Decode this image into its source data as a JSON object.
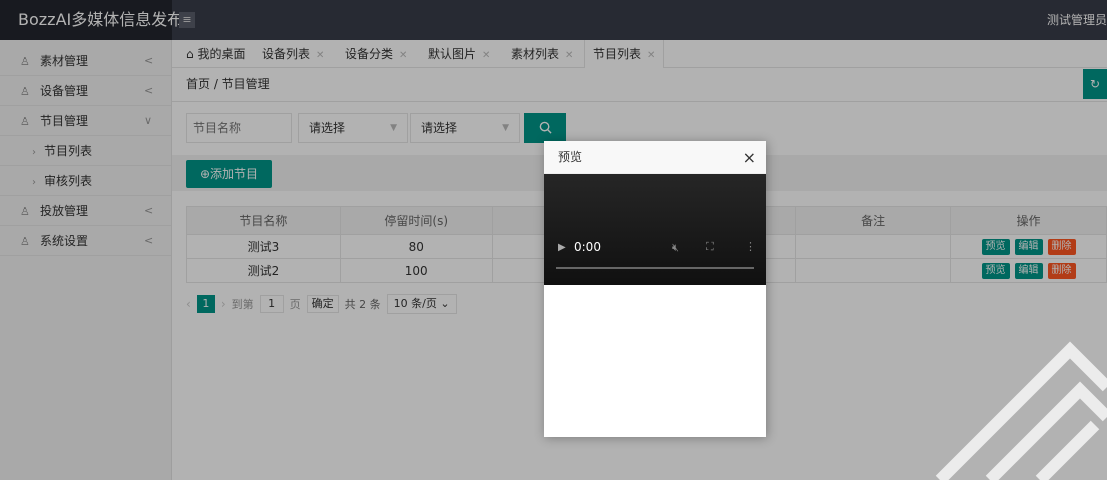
{
  "header": {
    "app_title": "BozzAI多媒体信息发布",
    "menu_toggle": "≡",
    "user": "测试管理员"
  },
  "sidebar": {
    "items": [
      {
        "label": "素材管理",
        "chevron": "<"
      },
      {
        "label": "设备管理",
        "chevron": "<"
      },
      {
        "label": "节目管理",
        "chevron": "∨"
      },
      {
        "label": "投放管理",
        "chevron": "<"
      },
      {
        "label": "系统设置",
        "chevron": "<"
      }
    ],
    "subitems": [
      {
        "label": "节目列表"
      },
      {
        "label": "审核列表"
      }
    ]
  },
  "tabs": [
    {
      "label": "我的桌面"
    },
    {
      "label": "设备列表"
    },
    {
      "label": "设备分类"
    },
    {
      "label": "默认图片"
    },
    {
      "label": "素材列表"
    },
    {
      "label": "节目列表"
    }
  ],
  "breadcrumb": "首页 / 节目管理",
  "search": {
    "name_placeholder": "节目名称",
    "select1": "请选择",
    "select2": "请选择"
  },
  "toolbar": {
    "add_label": "添加节目"
  },
  "table": {
    "headers": [
      "节目名称",
      "停留时间(s)",
      "",
      "",
      "备注",
      "操作"
    ],
    "rows": [
      {
        "name": "测试3",
        "duration": "80"
      },
      {
        "name": "测试2",
        "duration": "100"
      }
    ],
    "ops": {
      "preview": "预览",
      "edit": "编辑",
      "delete": "删除"
    }
  },
  "pager": {
    "current": "1",
    "goto": "到第",
    "goto_value": "1",
    "page_unit": "页",
    "confirm": "确定",
    "total": "共 2 条",
    "size": "10 条/页"
  },
  "modal": {
    "title": "预览",
    "close": "×",
    "video_time": "0:00"
  },
  "colors": {
    "accent": "#009688",
    "danger": "#ff5722",
    "header_bg": "#393d49"
  }
}
